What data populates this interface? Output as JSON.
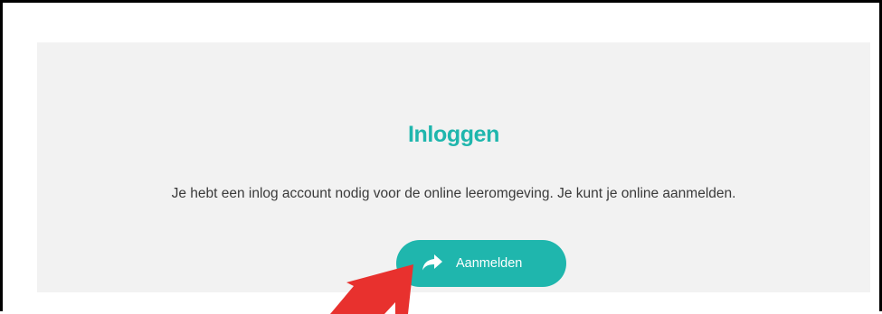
{
  "login": {
    "title": "Inloggen",
    "description": "Je hebt een inlog account nodig voor de online leeromgeving. Je kunt je online aanmelden.",
    "button_label": "Aanmelden",
    "button_icon": "share-arrow-icon"
  },
  "colors": {
    "accent": "#1fb6ad",
    "panel_background": "#f2f2f2",
    "arrow_annotation": "#e8312e"
  }
}
